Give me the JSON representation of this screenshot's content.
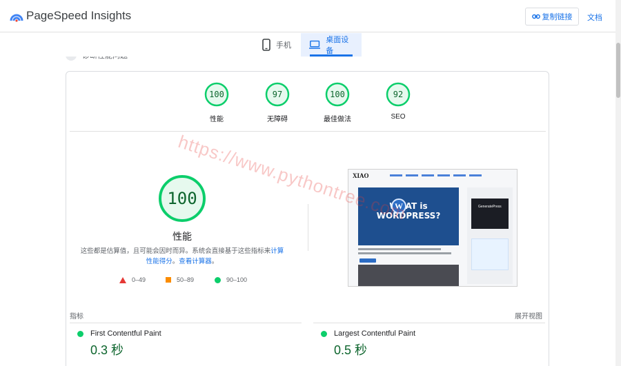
{
  "header": {
    "app_title": "PageSpeed Insights",
    "copy_link": "复制链接",
    "docs": "文档"
  },
  "tabs": [
    {
      "label": "手机",
      "icon": "phone-icon",
      "active": false
    },
    {
      "label": "桌面设备",
      "icon": "laptop-icon",
      "active": true
    }
  ],
  "partial_heading": "诊断性能问题",
  "categories": [
    {
      "score": "100",
      "label": "性能"
    },
    {
      "score": "97",
      "label": "无障碍"
    },
    {
      "score": "100",
      "label": "最佳做法"
    },
    {
      "score": "92",
      "label": "SEO"
    }
  ],
  "watermark": "https://www.pythontree.com",
  "performance": {
    "score": "100",
    "title": "性能",
    "disclaimer_prefix": "这些都是估算值，且可能会因时而异。系统会直接基于这些指标来",
    "disclaimer_link1": "计算性能得分",
    "disclaimer_sep": "。",
    "disclaimer_link2": "查看计算器",
    "disclaimer_suffix": "。"
  },
  "legend": [
    {
      "range": "0–49",
      "shape": "red-triangle",
      "color": "#e53935"
    },
    {
      "range": "50–89",
      "shape": "orange-square",
      "color": "#fb8c00"
    },
    {
      "range": "90–100",
      "shape": "green-circle",
      "color": "#0cce6b"
    }
  ],
  "thumbnail": {
    "logo": "XIAO",
    "hero_text": "WHAT is WORDPRESS?",
    "sidebar_brand": "GeneratePress"
  },
  "metrics": {
    "label": "指标",
    "expand": "展开视图",
    "items": [
      {
        "name": "First Contentful Paint",
        "value": "0.3 秒"
      },
      {
        "name": "Largest Contentful Paint",
        "value": "0.5 秒"
      }
    ]
  },
  "colors": {
    "good": "#0cce6b",
    "good_text": "#0d652d",
    "accent": "#1a73e8"
  }
}
